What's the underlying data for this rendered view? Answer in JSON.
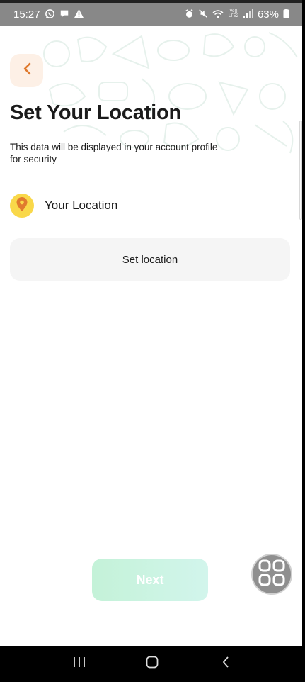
{
  "status_bar": {
    "time": "15:27",
    "battery": "63%",
    "network": "Vo)) LTE2"
  },
  "header": {
    "back_icon": "chevron-left-icon",
    "title": "Set Your Location",
    "subtitle": "This data will be displayed in your account profile for security"
  },
  "location": {
    "icon": "map-pin-icon",
    "label": "Your Location",
    "button_label": "Set location"
  },
  "footer": {
    "next_label": "Next"
  },
  "colors": {
    "accent_orange": "#e07a2e",
    "back_bg": "#fdf0e6",
    "pin_yellow": "#f9d84a",
    "next_green": "#c4f2d8"
  }
}
